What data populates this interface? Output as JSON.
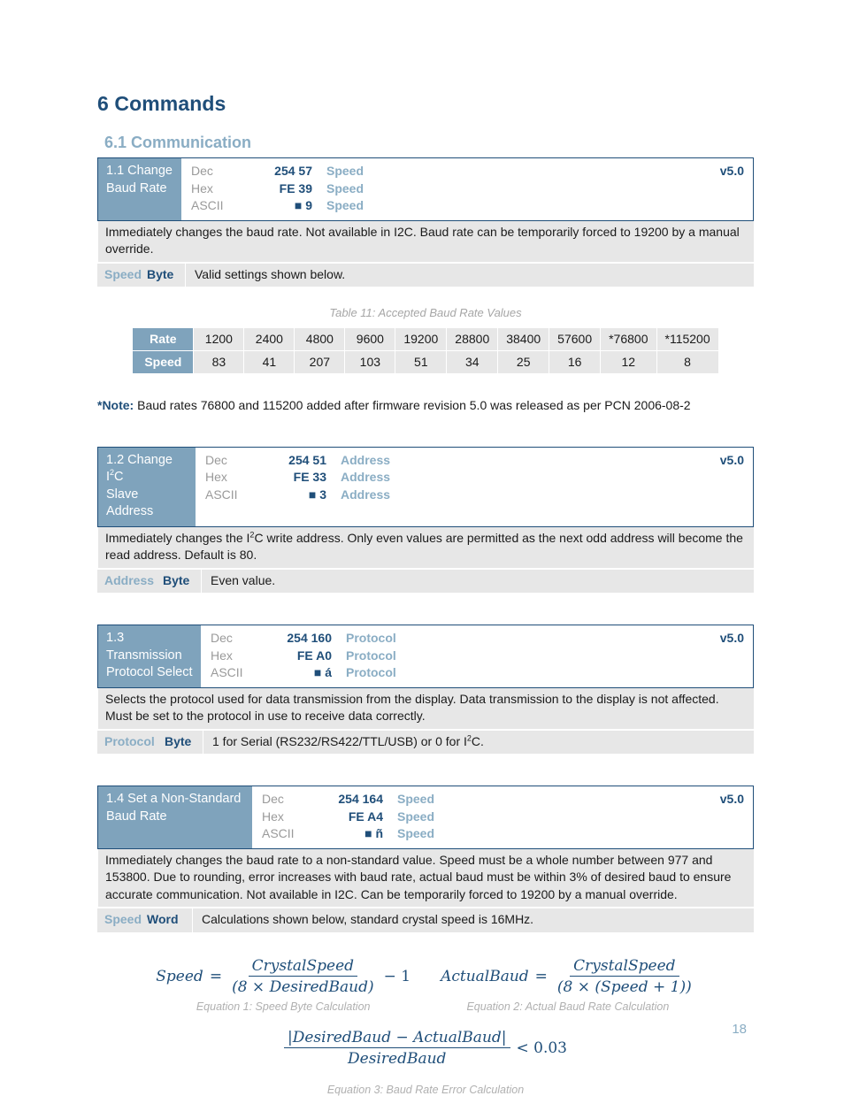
{
  "headings": {
    "chapter": "6 Commands",
    "section": "6.1 Communication"
  },
  "commands": [
    {
      "name_line1": "1.1 Change",
      "name_line2": "Baud Rate",
      "version": "v5.0",
      "rows": [
        {
          "label": "Dec",
          "value": "254 57",
          "arg": "Speed"
        },
        {
          "label": "Hex",
          "value": "FE 39",
          "arg": "Speed"
        },
        {
          "label": "ASCII",
          "value": "■ 9",
          "arg": "Speed"
        }
      ],
      "description": "Immediately changes the baud rate.  Not available in I2C.  Baud rate can be temporarily forced to 19200 by a manual override.",
      "param_name": "Speed",
      "param_type": "Byte",
      "param_desc": "Valid settings shown below."
    },
    {
      "name_line1_pre": "1.2 Change I",
      "name_line1_sup": "2",
      "name_line1_post": "C",
      "name_line2": "Slave Address",
      "version": "v5.0",
      "rows": [
        {
          "label": "Dec",
          "value": "254 51",
          "arg": "Address"
        },
        {
          "label": "Hex",
          "value": "FE 33",
          "arg": "Address"
        },
        {
          "label": "ASCII",
          "value": "■ 3",
          "arg": "Address"
        }
      ],
      "desc_pre": "Immediately changes the I",
      "desc_sup": "2",
      "desc_post": "C write address.  Only even values are permitted as the next odd address will become the read address.  Default is 80.",
      "param_name": "Address",
      "param_type": "Byte",
      "param_desc": "Even value."
    },
    {
      "name_line1": "1.3 Transmission",
      "name_line2": "Protocol Select",
      "version": "v5.0",
      "rows": [
        {
          "label": "Dec",
          "value": "254 160",
          "arg": "Protocol"
        },
        {
          "label": "Hex",
          "value": "FE A0",
          "arg": "Protocol"
        },
        {
          "label": "ASCII",
          "value": "■ á",
          "arg": "Protocol"
        }
      ],
      "description": "Selects the protocol used for data transmission from the display.  Data transmission to the display is not affected. Must be set to the protocol in use to receive data correctly.",
      "param_name": "Protocol",
      "param_type": "Byte",
      "param_desc_pre": "1 for Serial (RS232/RS422/TTL/USB) or 0 for I",
      "param_desc_sup": "2",
      "param_desc_post": "C."
    },
    {
      "name_line1": "1.4 Set a Non-Standard",
      "name_line2": "Baud Rate",
      "version": "v5.0",
      "rows": [
        {
          "label": "Dec",
          "value": "254 164",
          "arg": "Speed"
        },
        {
          "label": "Hex",
          "value": "FE A4",
          "arg": "Speed"
        },
        {
          "label": "ASCII",
          "value": "■ ñ",
          "arg": "Speed"
        }
      ],
      "description": "Immediately changes the baud rate to a non-standard value.  Speed must be a whole number between 977 and 153800.  Due to rounding, error increases with baud rate, actual baud must be within 3% of desired baud to ensure accurate communication.  Not available in I2C.  Can be temporarily forced to 19200 by a manual override.",
      "param_name": "Speed",
      "param_type": "Word",
      "param_desc": "Calculations shown below, standard crystal speed is 16MHz."
    }
  ],
  "baud_table": {
    "caption": "Table 11: Accepted Baud Rate Values",
    "row_headers": [
      "Rate",
      "Speed"
    ],
    "rates": [
      "1200",
      "2400",
      "4800",
      "9600",
      "19200",
      "28800",
      "38400",
      "57600",
      "*76800",
      "*115200"
    ],
    "speeds": [
      "83",
      "41",
      "207",
      "103",
      "51",
      "34",
      "25",
      "16",
      "12",
      "8"
    ]
  },
  "note": {
    "marker": "*Note:",
    "text": " Baud rates 76800 and 115200 added after firmware revision 5.0 was released as per PCN 2006-08-2"
  },
  "equations": [
    {
      "lhs": "Speed",
      "eq": "=",
      "numerator": "CrystalSpeed",
      "denominator": "(8 × DesiredBaud)",
      "tail": "− 1",
      "caption": "Equation 1: Speed Byte Calculation"
    },
    {
      "lhs": "ActualBaud",
      "eq": "=",
      "numerator": "CrystalSpeed",
      "denominator": "(8 × (Speed + 1))",
      "tail": "",
      "caption": "Equation 2: Actual Baud Rate Calculation"
    },
    {
      "lhs": "",
      "eq": "",
      "numerator": "|DesiredBaud − ActualBaud|",
      "denominator": "DesiredBaud",
      "tail": "< 0.03",
      "caption": "Equation 3: Baud Rate Error Calculation"
    }
  ],
  "page_number": "18",
  "colors": {
    "navy": "#1F4E79",
    "steel_blue": "#7FA3BC",
    "light_blue_text": "#8AADC4",
    "gray_row": "#E7E7E7",
    "gray_label": "#9A9A9A"
  }
}
